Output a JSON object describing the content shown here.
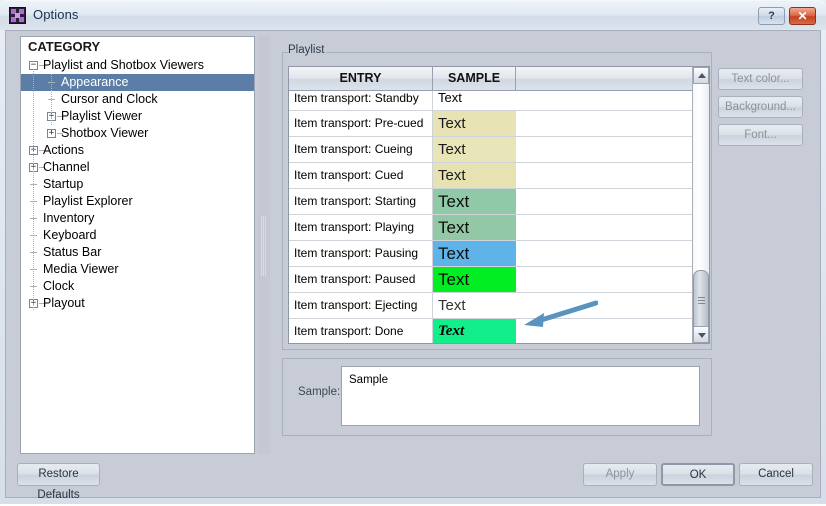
{
  "window": {
    "title": "Options",
    "icon": "options-app-icon",
    "help_button": "?",
    "close_button": "✕"
  },
  "category_panel": {
    "header": "CATEGORY",
    "tree": [
      {
        "label": "Playlist and Shotbox Viewers",
        "level": 0,
        "expander": "minus",
        "selected": false
      },
      {
        "label": "Appearance",
        "level": 1,
        "expander": "none",
        "selected": true
      },
      {
        "label": "Cursor and Clock",
        "level": 1,
        "expander": "none",
        "selected": false
      },
      {
        "label": "Playlist Viewer",
        "level": 1,
        "expander": "plus",
        "selected": false
      },
      {
        "label": "Shotbox Viewer",
        "level": 1,
        "expander": "plus",
        "selected": false
      },
      {
        "label": "Actions",
        "level": 0,
        "expander": "plus",
        "selected": false
      },
      {
        "label": "Channel",
        "level": 0,
        "expander": "plus",
        "selected": false
      },
      {
        "label": "Startup",
        "level": 0,
        "expander": "none",
        "selected": false
      },
      {
        "label": "Playlist Explorer",
        "level": 0,
        "expander": "none",
        "selected": false
      },
      {
        "label": "Inventory",
        "level": 0,
        "expander": "none",
        "selected": false
      },
      {
        "label": "Keyboard",
        "level": 0,
        "expander": "none",
        "selected": false
      },
      {
        "label": "Status Bar",
        "level": 0,
        "expander": "none",
        "selected": false
      },
      {
        "label": "Media Viewer",
        "level": 0,
        "expander": "none",
        "selected": false
      },
      {
        "label": "Clock",
        "level": 0,
        "expander": "none",
        "selected": false
      },
      {
        "label": "Playout",
        "level": 0,
        "expander": "plus",
        "selected": false
      }
    ]
  },
  "playlist_group": {
    "legend": "Playlist",
    "columns": [
      "ENTRY",
      "SAMPLE",
      ""
    ],
    "rows": [
      {
        "entry": "Item transport: Standby",
        "sample": "Text",
        "bg": "#ffffff",
        "fg": "#000000",
        "size": 13,
        "bold": false,
        "italic": false,
        "serif": false,
        "clipped": true
      },
      {
        "entry": "Item transport: Pre-cued",
        "sample": "Text",
        "bg": "#e8e3b4",
        "fg": "#1a1a1a",
        "size": 15,
        "bold": false,
        "italic": false,
        "serif": false,
        "clipped": false
      },
      {
        "entry": "Item transport: Cueing",
        "sample": "Text",
        "bg": "#e8e6b8",
        "fg": "#1a1a1a",
        "size": 15,
        "bold": false,
        "italic": false,
        "serif": false,
        "clipped": false
      },
      {
        "entry": "Item transport: Cued",
        "sample": "Text",
        "bg": "#e6e2b2",
        "fg": "#1a1a1a",
        "size": 15,
        "bold": false,
        "italic": false,
        "serif": false,
        "clipped": false
      },
      {
        "entry": "Item transport: Starting",
        "sample": "Text",
        "bg": "#8fc9a8",
        "fg": "#0d0d0d",
        "size": 17,
        "bold": false,
        "italic": false,
        "serif": false,
        "clipped": false
      },
      {
        "entry": "Item transport: Playing",
        "sample": "Text",
        "bg": "#93c8a6",
        "fg": "#0d0d0d",
        "size": 17,
        "bold": false,
        "italic": false,
        "serif": false,
        "clipped": false
      },
      {
        "entry": "Item transport: Pausing",
        "sample": "Text",
        "bg": "#5eb3e8",
        "fg": "#0d0d0d",
        "size": 17,
        "bold": false,
        "italic": false,
        "serif": false,
        "clipped": false
      },
      {
        "entry": "Item transport: Paused",
        "sample": "Text",
        "bg": "#00ee22",
        "fg": "#0d0d0d",
        "size": 17,
        "bold": false,
        "italic": false,
        "serif": false,
        "clipped": false
      },
      {
        "entry": "Item transport: Ejecting",
        "sample": "Text",
        "bg": "#ffffff",
        "fg": "#333333",
        "size": 15,
        "bold": false,
        "italic": false,
        "serif": false,
        "clipped": false
      },
      {
        "entry": "Item transport: Done",
        "sample": "Text",
        "bg": "#11ee8a",
        "fg": "#000000",
        "size": 15,
        "bold": true,
        "italic": true,
        "serif": true,
        "clipped": false
      }
    ],
    "scrollbar": {
      "up_arrow": "▲",
      "down_arrow": "▼",
      "thumb_position": "near-bottom"
    }
  },
  "format_buttons": {
    "text_color": "Text color...",
    "background": "Background...",
    "font": "Font..."
  },
  "sample_group": {
    "label": "Sample:",
    "value": "Sample",
    "placeholder": "Sample"
  },
  "footer": {
    "restore_defaults": "Restore Defaults",
    "apply": "Apply",
    "ok": "OK",
    "cancel": "Cancel"
  },
  "annotation": {
    "arrow": "left-pointing-arrow",
    "color": "#5b93c0"
  },
  "colors": {
    "selection": "#5c7ea6",
    "dialog_bg": "#c8ccd6",
    "titlebar_bg": "#e2e9f2",
    "close_button": "#c4411f"
  }
}
